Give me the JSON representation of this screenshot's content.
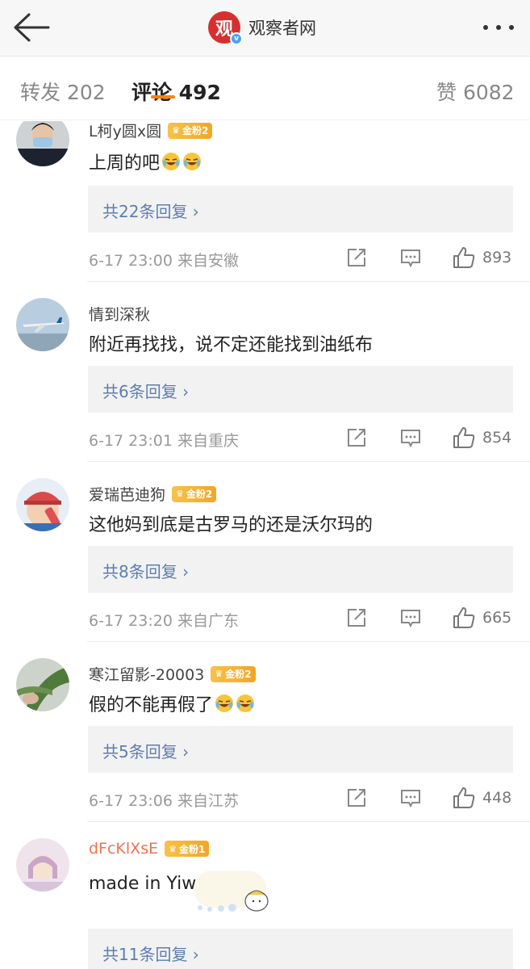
{
  "header": {
    "logo_char": "观",
    "verify_mark": "v",
    "title": "观察者网"
  },
  "tabs": {
    "repost": "转发 202",
    "comments": "评论 492",
    "likes": "赞 6082"
  },
  "comments": [
    {
      "name": "L柯y圆x圆",
      "badge": "金粉2",
      "text": "上周的吧",
      "replies": "共22条回复 ›",
      "time": "6-17 23:00  来自安徽",
      "likes": "893"
    },
    {
      "name": "情到深秋",
      "badge": "",
      "text": "附近再找找，说不定还能找到油纸布",
      "replies": "共6条回复 ›",
      "time": "6-17 23:01  来自重庆",
      "likes": "854"
    },
    {
      "name": "爱瑞芭迪狗",
      "badge": "金粉2",
      "text": "这他妈到底是古罗马的还是沃尔玛的",
      "replies": "共8条回复 ›",
      "time": "6-17 23:20  来自广东",
      "likes": "665"
    },
    {
      "name": "寒江留影-20003",
      "badge": "金粉2",
      "text": "假的不能再假了",
      "replies": "共5条回复 ›",
      "time": "6-17 23:06  来自江苏",
      "likes": "448"
    },
    {
      "name": "dFcKlXsE",
      "badge": "金粉1",
      "text": "made in Yiwu",
      "replies": "共11条回复 ›",
      "time": "",
      "likes": ""
    }
  ],
  "colors": {
    "accent": "#ff8200",
    "link": "#5d7eae",
    "badge": "#f3a623",
    "username_vip": "#eb7350"
  }
}
